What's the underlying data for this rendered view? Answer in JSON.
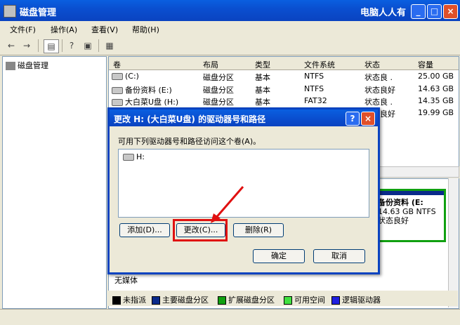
{
  "window": {
    "title": "磁盘管理",
    "brand": "电脑人人有",
    "controls": {
      "minimize": "_",
      "maximize": "□",
      "close": "×"
    }
  },
  "menu": [
    "文件(F)",
    "操作(A)",
    "查看(V)",
    "帮助(H)"
  ],
  "toolbar": {
    "icons": [
      "back-icon",
      "forward-icon",
      "show-hide-tree-icon",
      "help-icon",
      "properties-icon",
      "export-icon"
    ]
  },
  "tree": {
    "root": "磁盘管理"
  },
  "table": {
    "headers": [
      "卷",
      "布局",
      "类型",
      "文件系统",
      "状态",
      "容量"
    ],
    "rows": [
      {
        "volume": "(C:)",
        "layout": "磁盘分区",
        "type": "基本",
        "fs": "NTFS",
        "status": "状态良 .",
        "capacity": "25.00 GB"
      },
      {
        "volume": "备份资料 (E:)",
        "layout": "磁盘分区",
        "type": "基本",
        "fs": "NTFS",
        "status": "状态良好",
        "capacity": "14.63 GB"
      },
      {
        "volume": "大白菜U盘 (H:)",
        "layout": "磁盘分区",
        "type": "基本",
        "fs": "FAT32",
        "status": "状态良 .",
        "capacity": "14.35 GB"
      },
      {
        "volume": "",
        "layout": "",
        "type": "",
        "fs": "",
        "status": "状态良好",
        "capacity": "19.99 GB"
      }
    ]
  },
  "graph": {
    "disk_box": {
      "name": "备份资料 (E:",
      "size": "14.63 GB NTFS",
      "status": "状态良好"
    },
    "no_media": "无媒体"
  },
  "legend": [
    {
      "label": "未指派",
      "color": "#000000"
    },
    {
      "label": "主要磁盘分区",
      "color": "#0a2a8a"
    },
    {
      "label": "扩展磁盘分区",
      "color": "#10a010"
    },
    {
      "label": "可用空间",
      "color": "#40e040"
    },
    {
      "label": "逻辑驱动器",
      "color": "#2020e0"
    }
  ],
  "dialog": {
    "title": "更改 H: (大白菜U盘) 的驱动器号和路径",
    "prompt": "可用下列驱动器号和路径访问这个卷(A)。",
    "list_item": "H:",
    "buttons": {
      "add": "添加(D)...",
      "change": "更改(C)...",
      "remove": "删除(R)",
      "ok": "确定",
      "cancel": "取消"
    },
    "help": "?",
    "close": "×"
  }
}
